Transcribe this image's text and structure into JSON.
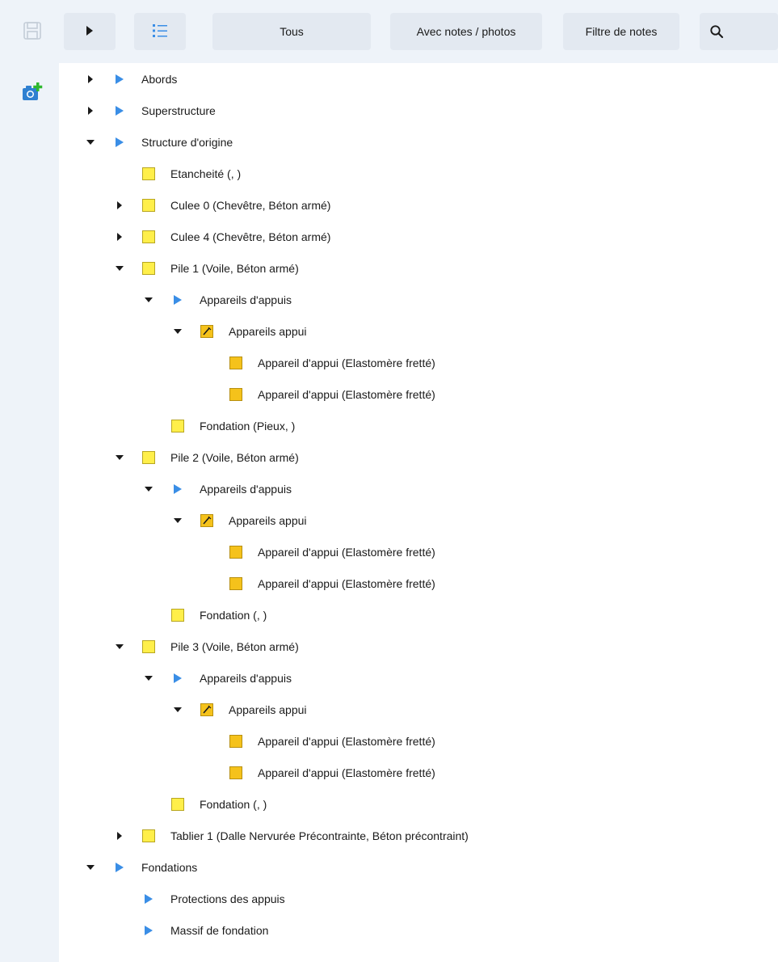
{
  "toolbar": {
    "tous_label": "Tous",
    "avec_notes_label": "Avec notes / photos",
    "filtre_label": "Filtre de notes"
  },
  "tree": {
    "abords": "Abords",
    "superstructure": "Superstructure",
    "structure_origine": "Structure d'origine",
    "etancheite": "Etancheité (, )",
    "culee0": "Culee 0 (Chevêtre, Béton armé)",
    "culee4": "Culee 4 (Chevêtre, Béton armé)",
    "pile1": "Pile 1 (Voile, Béton armé)",
    "pile1_appareils_appuis": "Appareils d'appuis",
    "pile1_appareils_appui": "Appareils appui",
    "pile1_appareil_a": "Appareil d'appui (Elastomère fretté)",
    "pile1_appareil_b": "Appareil d'appui (Elastomère fretté)",
    "pile1_fondation": "Fondation (Pieux, )",
    "pile2": "Pile 2 (Voile, Béton armé)",
    "pile2_appareils_appuis": "Appareils d'appuis",
    "pile2_appareils_appui": "Appareils appui",
    "pile2_appareil_a": "Appareil d'appui (Elastomère fretté)",
    "pile2_appareil_b": "Appareil d'appui (Elastomère fretté)",
    "pile2_fondation": "Fondation (, )",
    "pile3": "Pile 3 (Voile, Béton armé)",
    "pile3_appareils_appuis": "Appareils d'appuis",
    "pile3_appareils_appui": "Appareils appui",
    "pile3_appareil_a": "Appareil d'appui (Elastomère fretté)",
    "pile3_appareil_b": "Appareil d'appui (Elastomère fretté)",
    "pile3_fondation": "Fondation (, )",
    "tablier1": "Tablier 1 (Dalle Nervurée Précontrainte, Béton précontraint)",
    "fondations": "Fondations",
    "protections": "Protections des appuis",
    "massif": "Massif de fondation"
  },
  "colors": {
    "accent_blue": "#3a8ee6",
    "folder_yellow": "#ffef4a",
    "item_gold": "#f5c21b",
    "camera_blue": "#2f80d1",
    "camera_plus_green": "#2eb82e"
  }
}
